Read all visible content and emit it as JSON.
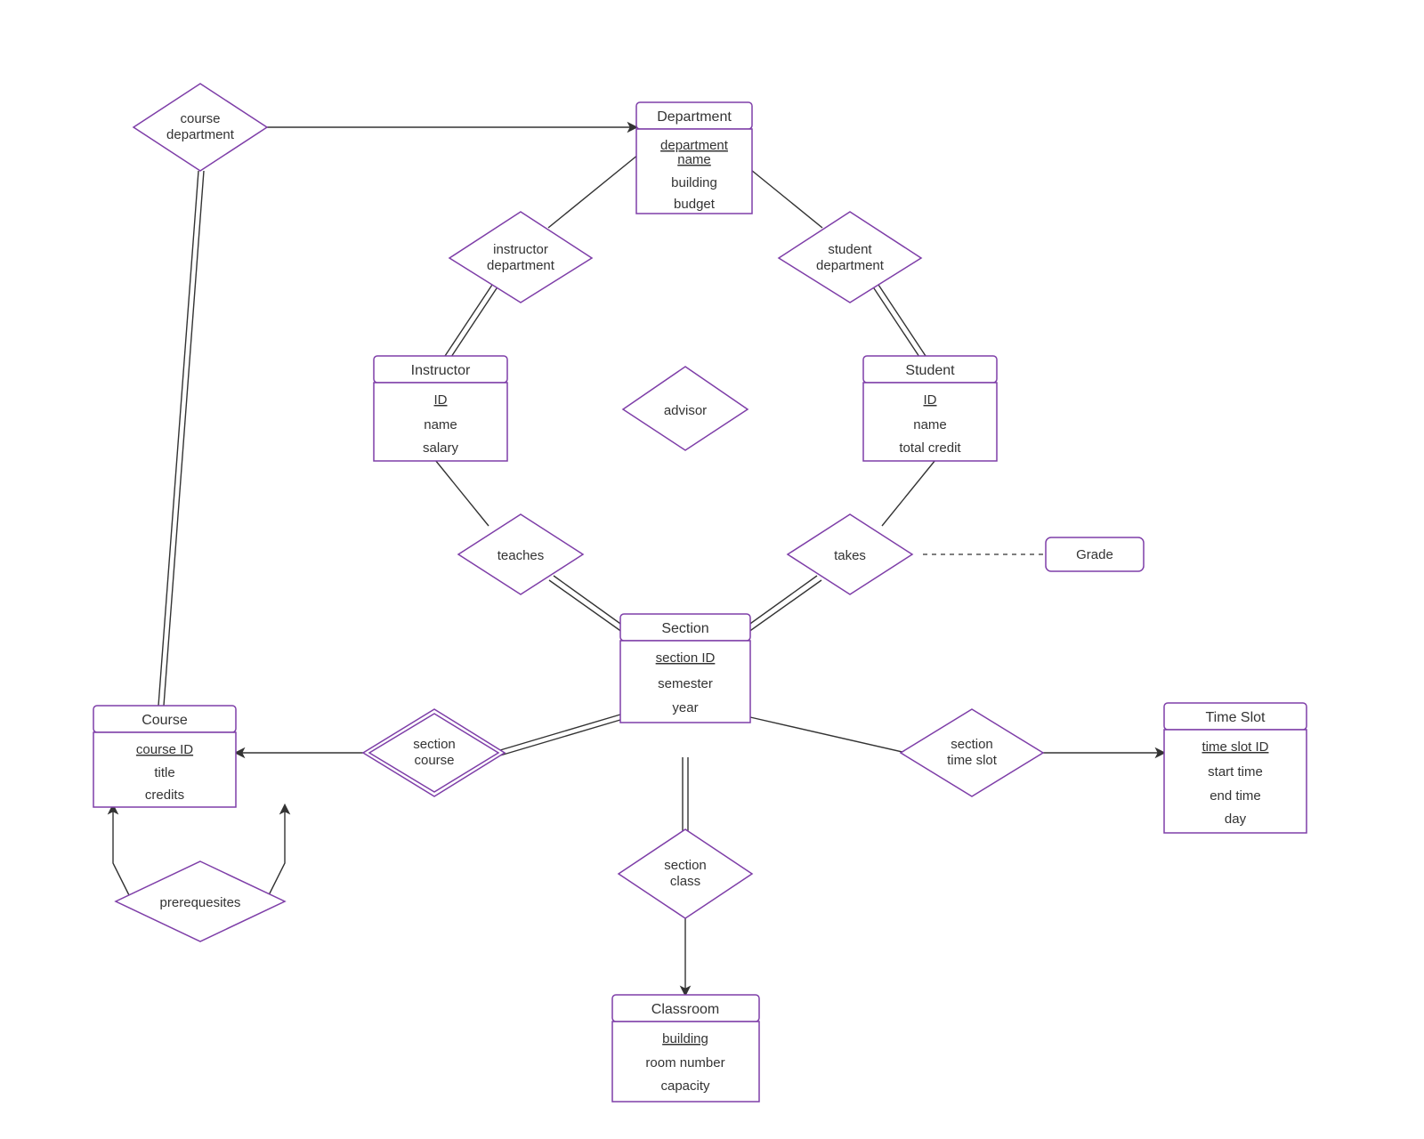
{
  "entities": {
    "department": {
      "title": "Department",
      "attrs": [
        "department name",
        "building",
        "budget"
      ],
      "key": 0
    },
    "instructor": {
      "title": "Instructor",
      "attrs": [
        "ID",
        "name",
        "salary"
      ],
      "key": 0
    },
    "student": {
      "title": "Student",
      "attrs": [
        "ID",
        "name",
        "total credit"
      ],
      "key": 0
    },
    "section": {
      "title": "Section",
      "attrs": [
        "section ID",
        "semester",
        "year"
      ],
      "key": 0
    },
    "course": {
      "title": "Course",
      "attrs": [
        "course ID",
        "title",
        "credits"
      ],
      "key": 0
    },
    "timeslot": {
      "title": "Time Slot",
      "attrs": [
        "time slot ID",
        "start time",
        "end time",
        "day"
      ],
      "key": 0
    },
    "classroom": {
      "title": "Classroom",
      "attrs": [
        "building",
        "room number",
        "capacity"
      ],
      "key": 0
    }
  },
  "relationships": {
    "course_department": {
      "l1": "course",
      "l2": "department"
    },
    "instructor_department": {
      "l1": "instructor",
      "l2": "department"
    },
    "student_department": {
      "l1": "student",
      "l2": "department"
    },
    "advisor": {
      "l1": "advisor",
      "l2": ""
    },
    "teaches": {
      "l1": "teaches",
      "l2": ""
    },
    "takes": {
      "l1": "takes",
      "l2": ""
    },
    "section_course": {
      "l1": "section",
      "l2": "course"
    },
    "section_time_slot": {
      "l1": "section",
      "l2": "time slot"
    },
    "section_class": {
      "l1": "section",
      "l2": "class"
    },
    "prerequisites": {
      "l1": "prerequesites",
      "l2": ""
    }
  },
  "nodes": {
    "grade": "Grade"
  }
}
